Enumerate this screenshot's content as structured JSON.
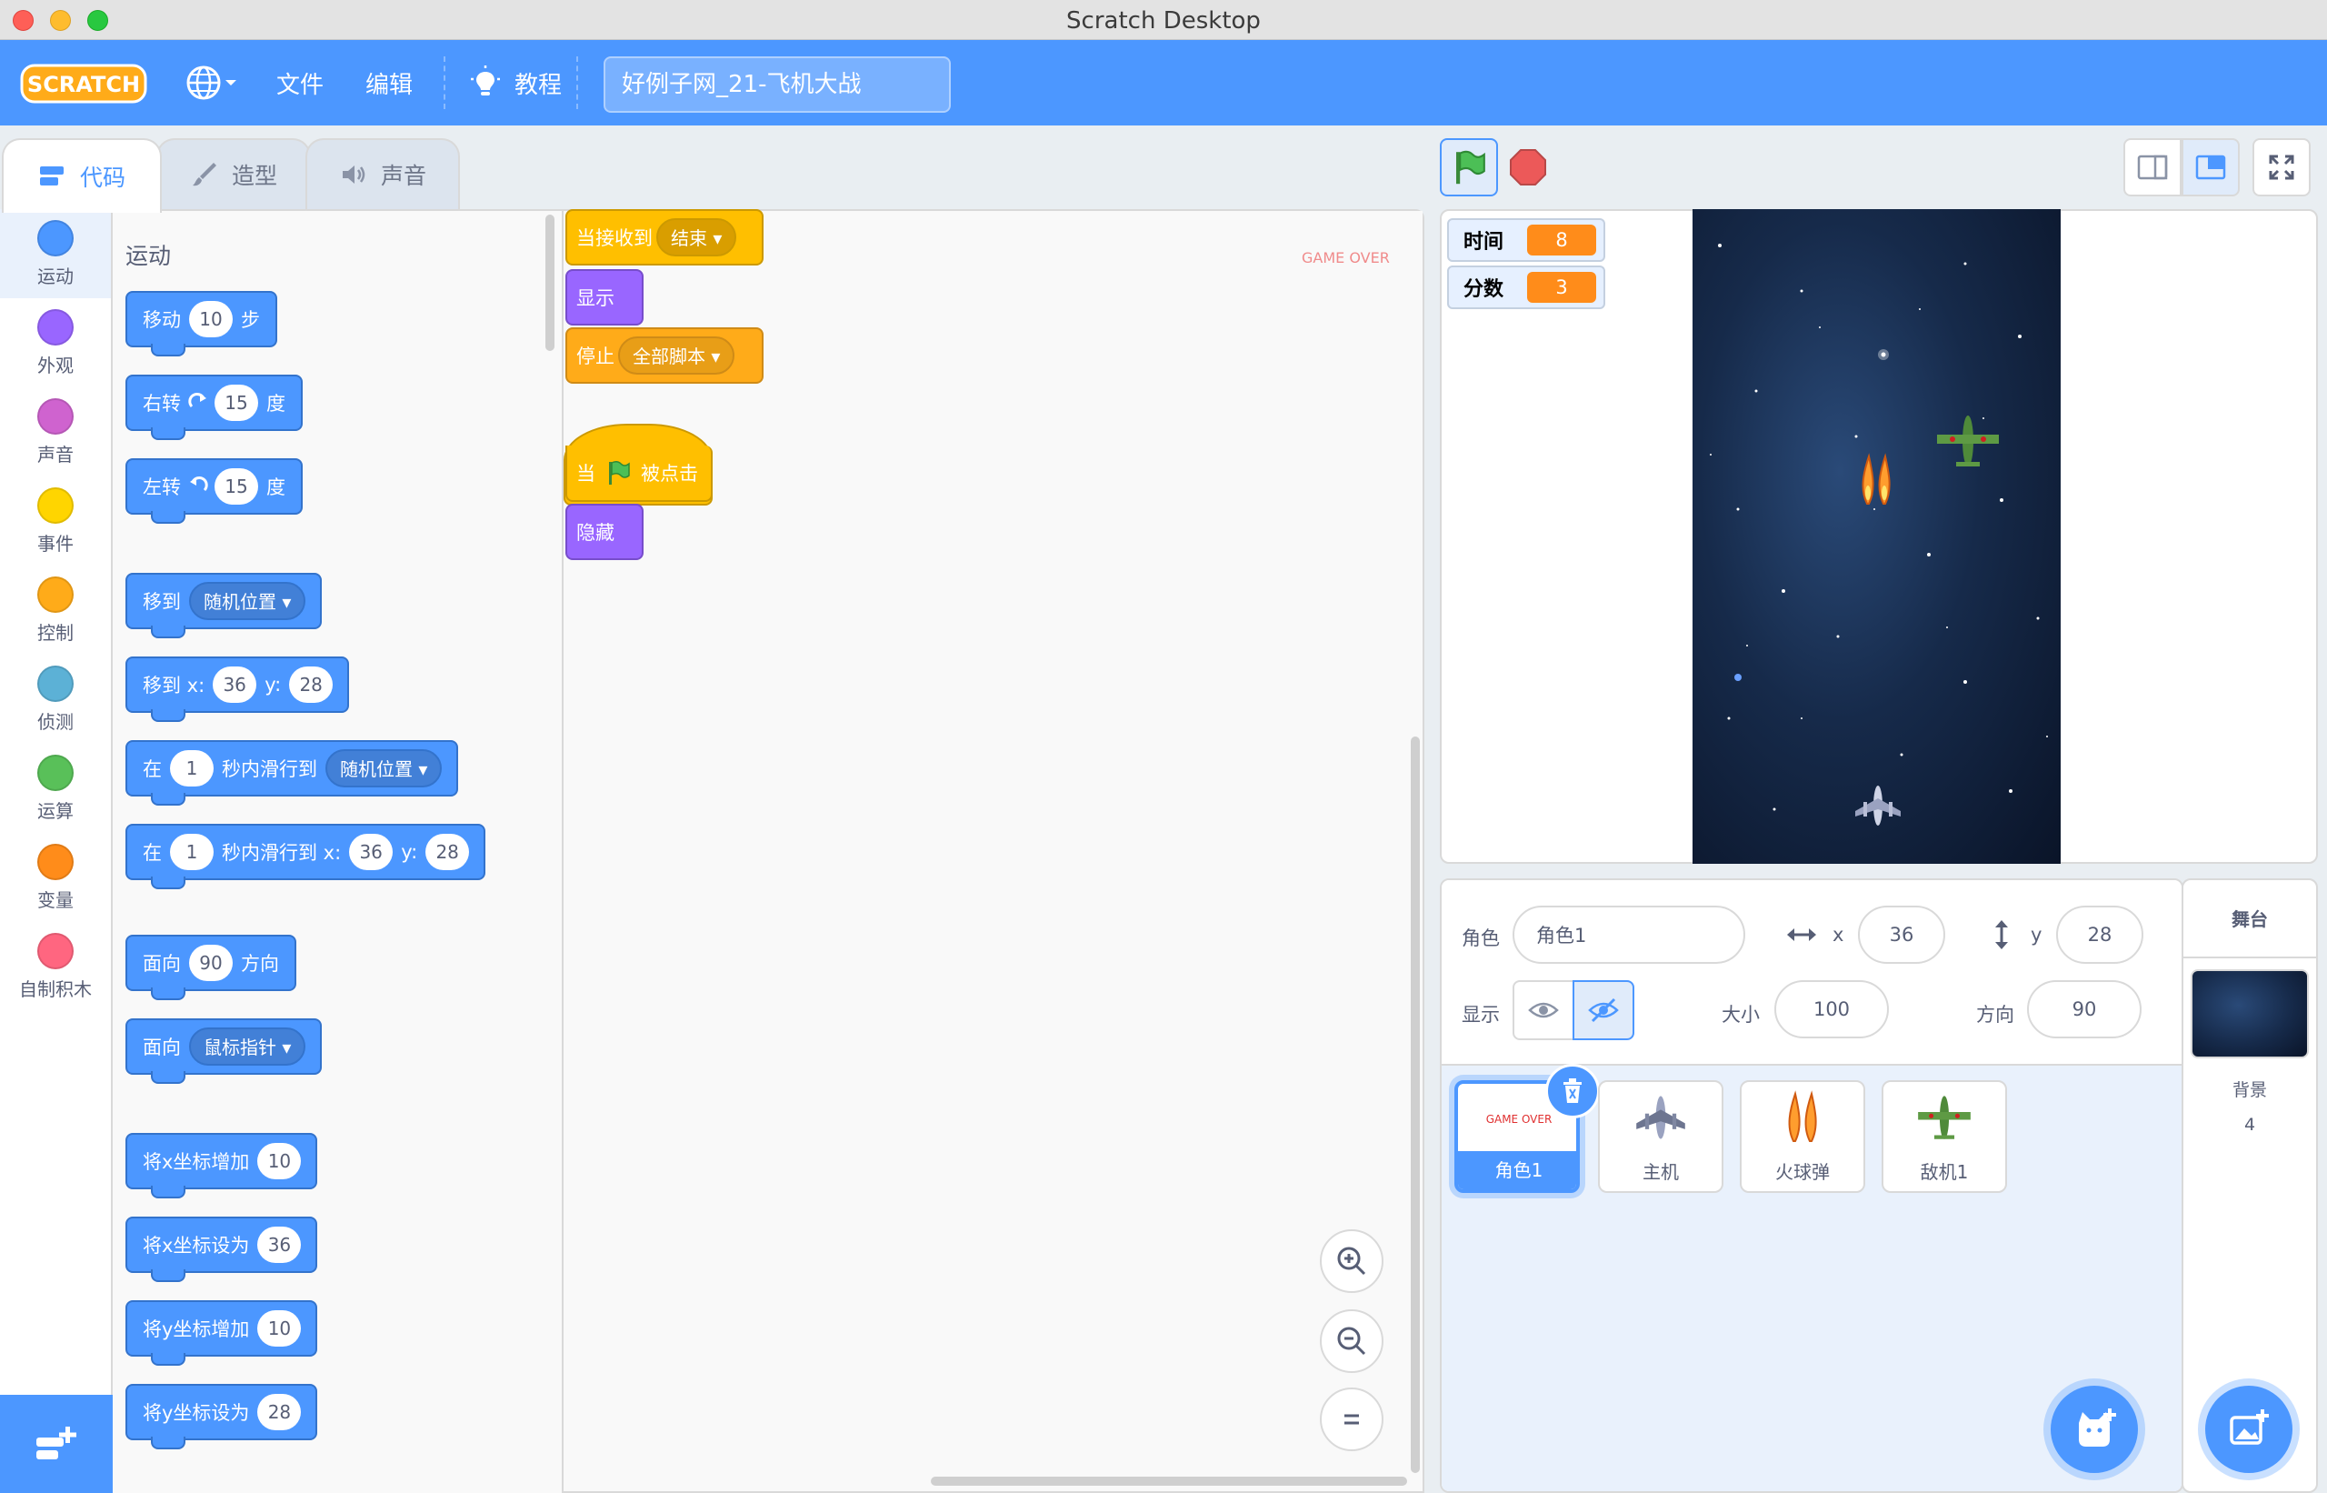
{
  "window": {
    "title": "Scratch Desktop"
  },
  "menubar": {
    "file": "文件",
    "edit": "编辑",
    "tutorials": "教程",
    "project_title": "好例子网_21-飞机大战"
  },
  "tabs": {
    "code": "代码",
    "costumes": "造型",
    "sounds": "声音"
  },
  "categories": [
    {
      "label": "运动",
      "color": "#4c97ff"
    },
    {
      "label": "外观",
      "color": "#9966ff"
    },
    {
      "label": "声音",
      "color": "#cf63cf"
    },
    {
      "label": "事件",
      "color": "#ffd500"
    },
    {
      "label": "控制",
      "color": "#ffab19"
    },
    {
      "label": "侦测",
      "color": "#5cb1d6"
    },
    {
      "label": "运算",
      "color": "#59c059"
    },
    {
      "label": "变量",
      "color": "#ff8c1a"
    },
    {
      "label": "自制积木",
      "color": "#ff6680"
    }
  ],
  "palette": {
    "section": "运动",
    "move": {
      "a": "移动",
      "v": "10",
      "b": "步"
    },
    "turn_right": {
      "a": "右转",
      "v": "15",
      "b": "度"
    },
    "turn_left": {
      "a": "左转",
      "v": "15",
      "b": "度"
    },
    "goto": {
      "a": "移到",
      "d": "随机位置"
    },
    "goto_xy": {
      "a": "移到 x:",
      "x": "36",
      "b": "y:",
      "y": "28"
    },
    "glide": {
      "a": "在",
      "v": "1",
      "b": "秒内滑行到",
      "d": "随机位置"
    },
    "glide_xy": {
      "a": "在",
      "v": "1",
      "b": "秒内滑行到 x:",
      "x": "36",
      "c": "y:",
      "y": "28"
    },
    "point_dir": {
      "a": "面向",
      "v": "90",
      "b": "方向"
    },
    "point_towards": {
      "a": "面向",
      "d": "鼠标指针"
    },
    "change_x": {
      "a": "将x坐标增加",
      "v": "10"
    },
    "set_x": {
      "a": "将x坐标设为",
      "v": "36"
    },
    "change_y": {
      "a": "将y坐标增加",
      "v": "10"
    },
    "set_y": {
      "a": "将y坐标设为",
      "v": "28"
    }
  },
  "script": {
    "when_receive": "当接收到",
    "message": "结束",
    "show": "显示",
    "stop": "停止",
    "stop_option": "全部脚本",
    "when_flag_a": "当",
    "when_flag_b": "被点击",
    "hide": "隐藏",
    "costume_label": "GAME OVER"
  },
  "monitors": [
    {
      "label": "时间",
      "value": "8"
    },
    {
      "label": "分数",
      "value": "3"
    }
  ],
  "sprite_info": {
    "sprite_label": "角色",
    "sprite_name": "角色1",
    "x_label": "x",
    "x": "36",
    "y_label": "y",
    "y": "28",
    "show_label": "显示",
    "size_label": "大小",
    "size": "100",
    "direction_label": "方向",
    "direction": "90"
  },
  "sprites": [
    {
      "name": "角色1",
      "thumb": "GAME OVER"
    },
    {
      "name": "主机"
    },
    {
      "name": "火球弹"
    },
    {
      "name": "敌机1"
    }
  ],
  "stage_pane": {
    "title": "舞台",
    "backdrop_label": "背景",
    "backdrop_count": "4"
  },
  "colors": {
    "accent": "#4c97ff",
    "event": "#ffbf00",
    "looks": "#9966ff",
    "control": "#ffab19",
    "variable": "#ff8c1a"
  }
}
